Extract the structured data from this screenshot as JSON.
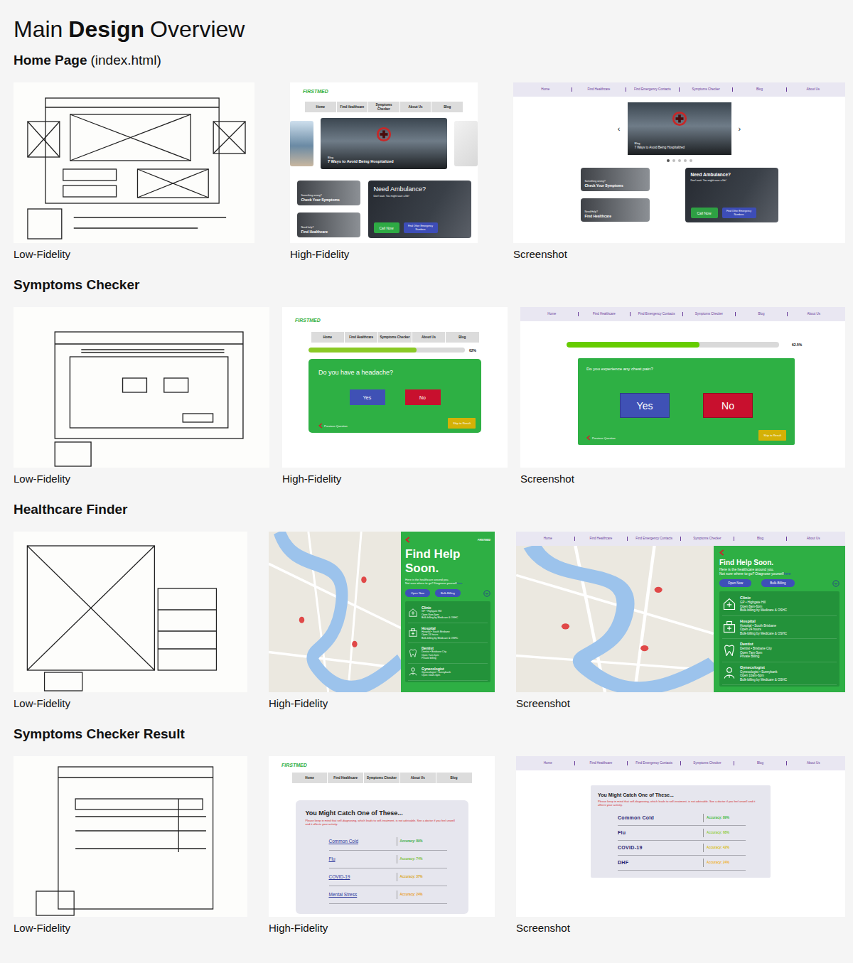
{
  "title": [
    {
      "text": "Main",
      "bold": false
    },
    {
      "text": "Design",
      "bold": true
    },
    {
      "text": "Overview",
      "bold": false
    }
  ],
  "sections": [
    {
      "kind": "home",
      "heading": "Home Page",
      "note": "(index.html)",
      "sketch": {
        "caption": "Low-Fidelity"
      },
      "hifi": {
        "caption": "High-Fidelity",
        "logo": "FIRSTMED",
        "nav": [
          "Home",
          "Find Healthcare",
          "Symptoms Checker",
          "About Us",
          "Blog"
        ],
        "blog_label": "Blog",
        "blog_title": "7 Ways to Avoid Being Hospitalized",
        "cards": [
          {
            "small": "Something wrong?",
            "title": "Check Your Symptoms"
          },
          {
            "small": "Need help?",
            "title": "Find Healthcare"
          }
        ],
        "ambulance": {
          "title": "Need Ambulance?",
          "sub": "Don't wait. You might save a life!",
          "call": "Call Now",
          "other": "Find Other Emergency Numbers"
        }
      },
      "screenshot": {
        "caption": "Screenshot",
        "nav": [
          "Home",
          "Find Healthcare",
          "Find Emergency Contacts",
          "Symptoms Checker",
          "Blog",
          "About Us"
        ],
        "prev": "‹",
        "next": "›",
        "blog_label": "Blog",
        "blog_title": "7 Ways to Avoid Being Hospitalized",
        "dots": [
          {
            "selected": true
          },
          {
            "selected": false
          },
          {
            "selected": false
          },
          {
            "selected": false
          },
          {
            "selected": false
          }
        ],
        "cards": [
          {
            "small": "Something wrong?",
            "title": "Check Your Symptoms"
          },
          {
            "small": "Need Help?",
            "title": "Find Healthcare"
          }
        ],
        "ambulance": {
          "title": "Need Ambulance?",
          "sub": "Don't wait. You might save a life!",
          "call": "Call Now",
          "other": "Find Other Emergency Numbers"
        }
      }
    },
    {
      "kind": "checker",
      "heading": "Symptoms Checker",
      "sketch": {
        "caption": "Low-Fidelity"
      },
      "hifi": {
        "caption": "High-Fidelity",
        "logo": "FIRSTMED",
        "nav": [
          "Home",
          "Find Healthcare",
          "Symptoms Checker",
          "About Us",
          "Blog"
        ],
        "level": 0.69,
        "reading": "62%",
        "question": "Do you have a headache?",
        "yes": "Yes",
        "no": "No",
        "back": "Previous Question",
        "skip": "Skip to Result"
      },
      "screenshot": {
        "caption": "Screenshot",
        "nav": [
          "Home",
          "Find Healthcare",
          "Find Emergency Contacts",
          "Symptoms Checker",
          "Blog",
          "About Us"
        ],
        "level": 0.625,
        "reading": "62.5%",
        "question": "Do you experience any chest pain?",
        "yes": "Yes",
        "no": "No",
        "back": "Previous Question",
        "skip": "Skip to Result"
      }
    },
    {
      "kind": "finder",
      "heading": "Healthcare Finder",
      "sketch": {
        "caption": "Low-Fidelity"
      },
      "hifi": {
        "caption": "High-Fidelity",
        "logo": "FIRSTMED",
        "title": "Find Help Soon.",
        "intro": [
          "Here is the healthcare around you.",
          "Not sure where to go? Diagnose yourself"
        ],
        "link": "here",
        "filters": [
          "Open Now",
          "Bulk-Billing"
        ],
        "places": [
          {
            "kind": "clinic",
            "type": "Clinic",
            "detail": "GP • Highgate Hill",
            "hours": "Open 8am-6pm",
            "billing": "Bulk-billing by Medicare & OSHC"
          },
          {
            "kind": "hospital",
            "type": "Hospital",
            "detail": "Hospital • South Brisbane",
            "hours": "Open 24 hours",
            "billing": "Bulk-billing by Medicare & OSHC"
          },
          {
            "kind": "dentist",
            "type": "Dentist",
            "detail": "Dentist • Brisbane City",
            "hours": "Open 7am-5pm",
            "billing": "Private billing"
          },
          {
            "kind": "gynecologist",
            "type": "Gynecologist",
            "detail": "Gynecologist • Sunnybank",
            "hours": "Open 10am-6pm"
          }
        ]
      },
      "screenshot": {
        "caption": "Screenshot",
        "nav": [
          "Home",
          "Find Healthcare",
          "Find Emergency Contacts",
          "Symptoms Checker",
          "Blog",
          "About Us"
        ],
        "title": "Find Help Soon.",
        "intro": [
          "Here is the healthcare around you.",
          "Not sure where to go? Diagnose yourself"
        ],
        "link": "here",
        "filters": [
          "Open Now",
          "Bulk-Billing"
        ],
        "places": [
          {
            "kind": "clinic",
            "type": "Clinic",
            "detail": "GP • Highgate Hill",
            "hours": "Open 8am-6pm",
            "billing": "Bulk-billing by Medicare & OSHC"
          },
          {
            "kind": "hospital",
            "type": "Hospital",
            "detail": "Hospital • South Brisbane",
            "hours": "Open 24 hours",
            "billing": "Bulk-billing by Medicare & OSHC"
          },
          {
            "kind": "dentist",
            "type": "Dentist",
            "detail": "Dentist • Brisbane City",
            "hours": "Open 7am-3pm",
            "billing": "Private Billing"
          },
          {
            "kind": "gynecologist",
            "type": "Gynecologist",
            "detail": "Gynecologist • Sunnybank",
            "hours": "Open 10am-6pm",
            "billing": "Bulk-billing by Medicare & OSHC"
          }
        ]
      }
    },
    {
      "kind": "result",
      "heading": "Symptoms Checker Result",
      "sketch": {
        "caption": "Low-Fidelity"
      },
      "hifi": {
        "caption": "High-Fidelity",
        "logo": "FIRSTMED",
        "nav": [
          "Home",
          "Find Healthcare",
          "Symptoms Checker",
          "About Us",
          "Blog"
        ],
        "title": "You Might Catch One of These...",
        "warning": "Please keep in mind that self-diagnosing, which leads to self-treatment, is not advisable. See a doctor if you feel unwell and it affects your activity.",
        "results": [
          {
            "name": "Common Cold",
            "accuracy": "Accuracy: 89%",
            "color": "#3fae49"
          },
          {
            "name": "Flu",
            "accuracy": "Accuracy: 74%",
            "color": "#7cbf3a"
          },
          {
            "name": "COVID-19",
            "accuracy": "Accuracy: 37%",
            "color": "#d9a414"
          },
          {
            "name": "Mental Stress",
            "accuracy": "Accuracy: 24%",
            "color": "#e89a1c"
          }
        ]
      },
      "screenshot": {
        "caption": "Screenshot",
        "nav": [
          "Home",
          "Find Healthcare",
          "Find Emergency Contacts",
          "Symptoms Checker",
          "Blog",
          "About Us"
        ],
        "title": "You Might Catch One of These...",
        "warning": "Please keep in mind that self-diagnosing, which leads to self-treatment, is not advisable. See a doctor if you feel unwell and it affects your activity.",
        "results": [
          {
            "name": "Common Cold",
            "accuracy": "Accuracy: 89%",
            "color": "#3dbb3d"
          },
          {
            "name": "Flu",
            "accuracy": "Accuracy: 68%",
            "color": "#8fcc3f"
          },
          {
            "name": "COVID-19",
            "accuracy": "Accuracy: 42%",
            "color": "#d8bc10"
          },
          {
            "name": "DHF",
            "accuracy": "Accuracy: 24%",
            "color": "#f0b02a"
          }
        ]
      }
    }
  ]
}
